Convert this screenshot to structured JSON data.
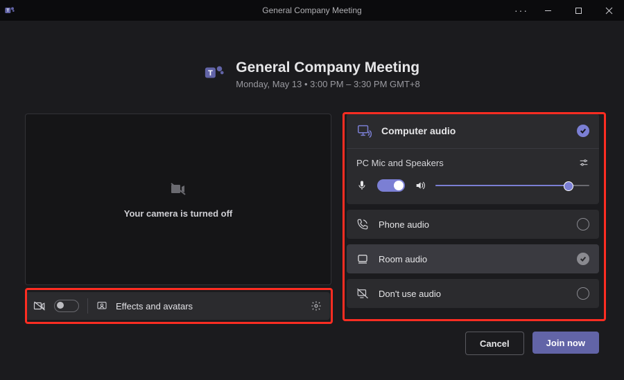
{
  "window": {
    "title": "General Company Meeting"
  },
  "header": {
    "title": "General Company Meeting",
    "subtitle": "Monday, May 13  •  3:00 PM  –  3:30 PM GMT+8"
  },
  "preview": {
    "camera_off_text": "Your camera is turned off"
  },
  "controls": {
    "effects_label": "Effects and avatars"
  },
  "audio": {
    "computer": {
      "label": "Computer audio",
      "selected": true
    },
    "device_name": "PC Mic and Speakers",
    "mic_on": true,
    "volume_pct": 86,
    "options": {
      "phone": "Phone audio",
      "room": "Room audio",
      "none": "Don't use audio"
    }
  },
  "footer": {
    "cancel": "Cancel",
    "join": "Join now"
  }
}
